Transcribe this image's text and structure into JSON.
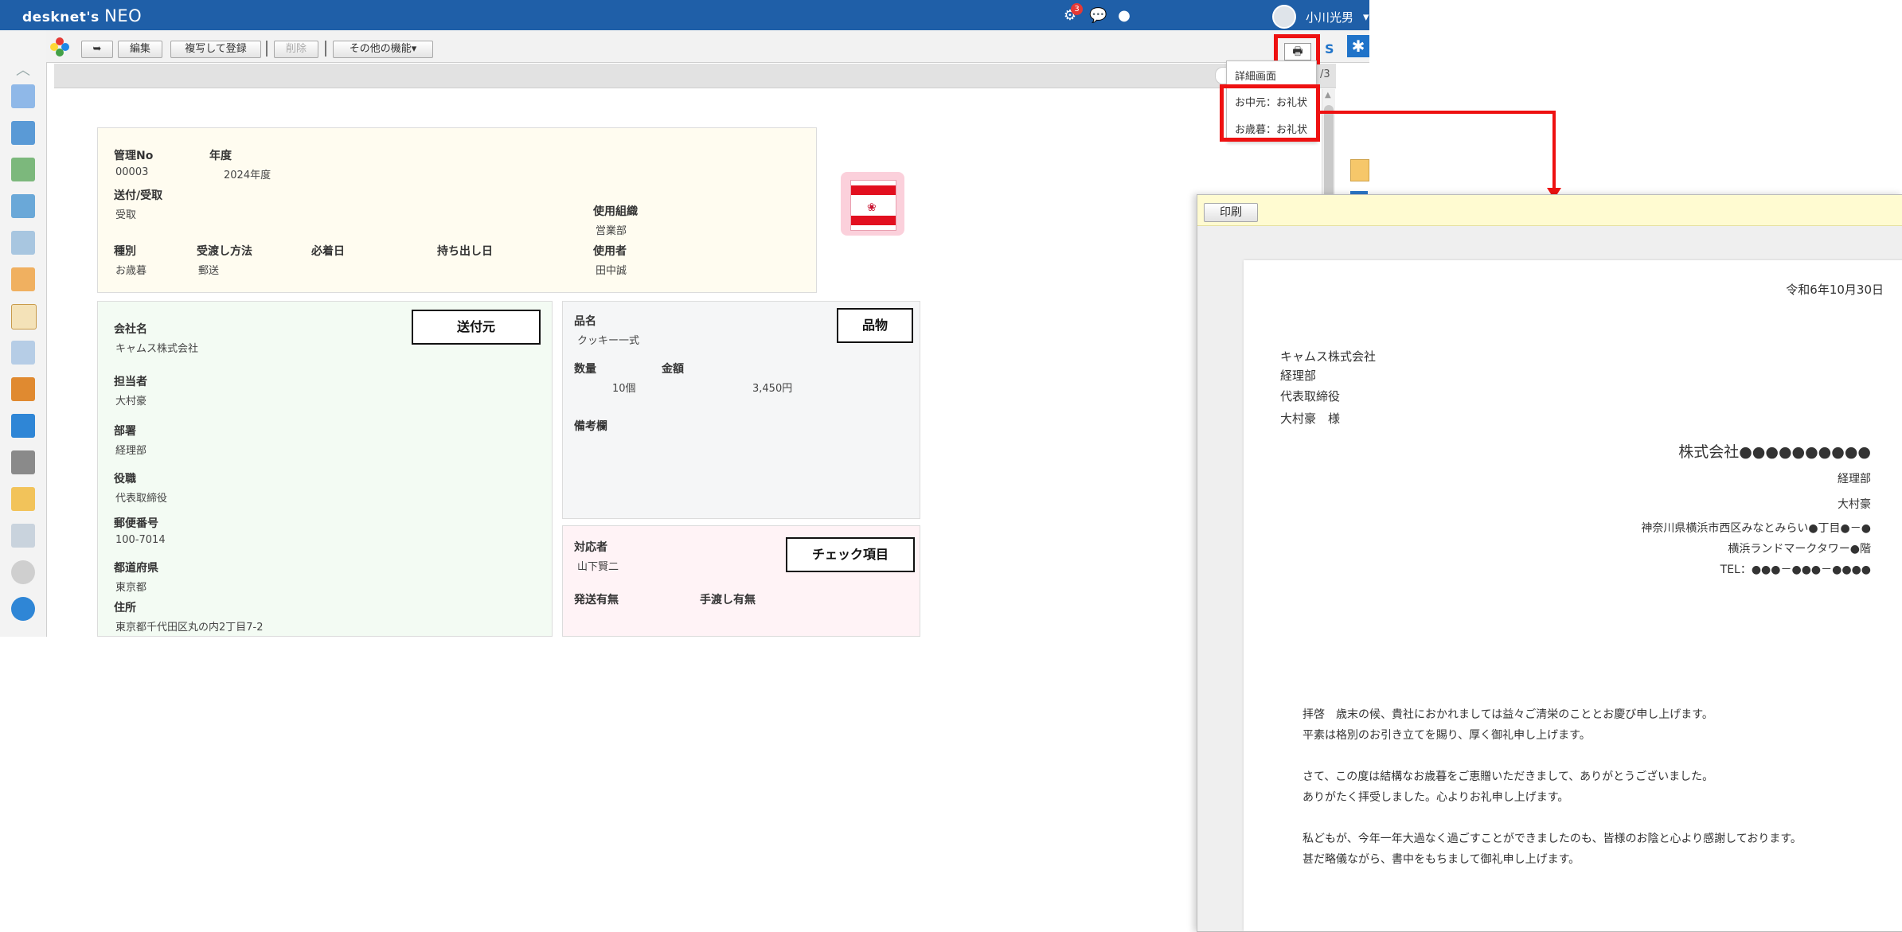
{
  "app": {
    "brand": "desknet's",
    "brand_neo": "NEO",
    "user_name": "小川光男",
    "notification_count": "3"
  },
  "toolbar": {
    "back_label": "",
    "edit_label": "編集",
    "copy_register_label": "複写して登録",
    "delete_label": "削除",
    "other_functions_label": "その他の機能"
  },
  "print_menu": {
    "items": [
      "詳細画面",
      "お中元：お礼状",
      "お歳暮：お礼状"
    ],
    "page_indicator": "/3"
  },
  "record": {
    "mgmt_no_label": "管理No",
    "mgmt_no": "00003",
    "year_label": "年度",
    "year": "2024年度",
    "send_receive_label": "送付/受取",
    "send_receive": "受取",
    "org_label": "使用組織",
    "org": "営業部",
    "type_label": "種別",
    "type": "お歳暮",
    "delivery_label": "受渡し方法",
    "delivery": "郵送",
    "arrival_label": "必着日",
    "carry_label": "持ち出し日",
    "user_label": "使用者",
    "user": "田中誠"
  },
  "sender": {
    "tag": "送付元",
    "company_label": "会社名",
    "company": "キャムス株式会社",
    "person_label": "担当者",
    "person": "大村豪",
    "dept_label": "部署",
    "dept": "経理部",
    "title_label": "役職",
    "title": "代表取締役",
    "zip_label": "郵便番号",
    "zip": "100-7014",
    "pref_label": "都道府県",
    "pref": "東京都",
    "addr_label": "住所",
    "addr": "東京都千代田区丸の内2丁目7-2"
  },
  "item": {
    "tag": "品物",
    "name_label": "品名",
    "name": "クッキー一式",
    "qty_label": "数量",
    "qty": "10個",
    "amount_label": "金額",
    "amount": "3,450円",
    "note_label": "備考欄"
  },
  "check": {
    "tag": "チェック項目",
    "handler_label": "対応者",
    "handler": "山下賢二",
    "ship_label": "発送有無",
    "handover_label": "手渡し有無"
  },
  "preview": {
    "print_label": "印刷",
    "date": "令和6年10月30日",
    "to_company": "キャムス株式会社",
    "to_dept": "経理部",
    "to_title": "代表取締役",
    "to_name": "大村豪　様",
    "from_company": "株式会社●●●●●●●●●●",
    "from_dept": "経理部",
    "from_name": "大村豪",
    "from_addr1": "神奈川県横浜市西区みなとみらい●丁目●－●",
    "from_addr2": "横浜ランドマークタワー●階",
    "from_tel": "TEL：●●●－●●●－●●●●",
    "body1": "拝啓　歳末の候、貴社におかれましては益々ご清栄のこととお慶び申し上げます。",
    "body2": "平素は格別のお引き立てを賜り、厚く御礼申し上げます。",
    "body3": "さて、この度は結構なお歳暮をご恵贈いただきまして、ありがとうございました。",
    "body4": "ありがたく拝受しました。心よりお礼申し上げます。",
    "body5": "私どもが、今年一年大過なく過ごすことができましたのも、皆様のお陰と心より感謝しております。",
    "body6": "甚だ略儀ながら、書中をもちまして御礼申し上げます。"
  },
  "colors": {
    "topbar": "#1f5fa8",
    "highlight": "#ee1111",
    "panel_yellow": "#fffcf0",
    "panel_green": "#f3fbf3",
    "panel_gray": "#f5f6f7",
    "panel_pink": "#fff3f6"
  }
}
